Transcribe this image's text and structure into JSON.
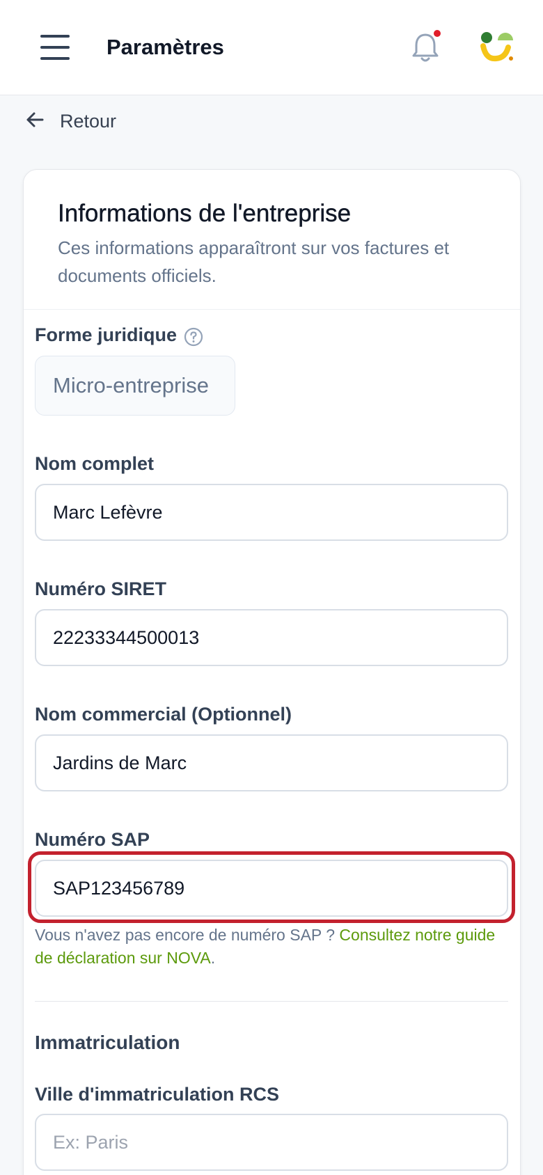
{
  "header": {
    "title": "Paramètres",
    "menu_icon": "hamburger-menu-icon",
    "notification_icon": "bell-icon",
    "notification_dot_color": "#e11d2a",
    "avatar_icon": "brand-logo-icon"
  },
  "back": {
    "label": "Retour",
    "icon": "arrow-left-icon"
  },
  "card": {
    "title": "Informations de l'entreprise",
    "subtitle": "Ces informations apparaîtront sur vos factures et documents officiels."
  },
  "form": {
    "legal_form": {
      "label": "Forme juridique",
      "value": "Micro-entreprise",
      "help_icon": "question-circle-icon"
    },
    "full_name": {
      "label": "Nom complet",
      "value": "Marc Lefèvre"
    },
    "siret": {
      "label": "Numéro SIRET",
      "value": "22233344500013"
    },
    "trade_name": {
      "label": "Nom commercial (Optionnel)",
      "value": "Jardins de Marc"
    },
    "sap": {
      "label": "Numéro SAP",
      "value": "SAP123456789",
      "hint_text": "Vous n'avez pas encore de numéro SAP ? ",
      "hint_link": "Consultez notre guide de déclaration sur NOVA",
      "hint_end": ".",
      "highlight_color": "#c3212e"
    },
    "registration": {
      "section_title": "Immatriculation",
      "rcs_city": {
        "label": "Ville d'immatriculation RCS",
        "value": "",
        "placeholder": "Ex: Paris"
      }
    }
  },
  "colors": {
    "link": "#5c9a0c",
    "background": "#f6f8fa"
  }
}
